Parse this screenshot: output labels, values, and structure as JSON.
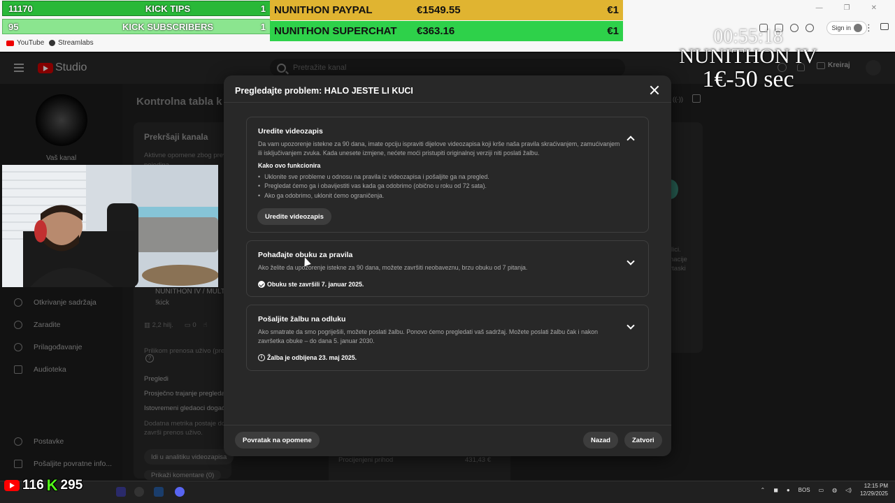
{
  "overlay": {
    "row1": {
      "num": "11170",
      "label": "KICK TIPS",
      "val": "1"
    },
    "row2": {
      "num": "95",
      "label": "KICK SUBSCRIBERS",
      "val": "1"
    },
    "paypal": {
      "name": "NUNITHON PAYPAL",
      "amount": "€1549.55",
      "val": "€1"
    },
    "superchat": {
      "name": "NUNITHON SUPERCHAT",
      "amount": "€363.16",
      "val": "€1"
    },
    "timer_top": "00:55:18",
    "timer_title": "NUNITHON IV",
    "timer_rate": "1€-50 sec",
    "youtube_count": "116",
    "kick_count": "295"
  },
  "browser": {
    "bookmarks": [
      "YouTube",
      "Streamlabs"
    ],
    "sign_in": "Sign in"
  },
  "studio": {
    "logo": "Studio",
    "search_placeholder": "Pretražite kanal",
    "create": "Kreiraj",
    "channel_label": "Vaš kanal",
    "dashboard_title": "Kontrolna tabla k",
    "card_title": "Prekršaji kanala",
    "card_line1": "Aktivne opomene zbog prevcr",
    "card_line2": "pojedina",
    "video_title": "NUNITHON IV / MULT",
    "video_sub": "!kick",
    "video_views": "2,2 hilj.",
    "video_comments": "0",
    "stats_note": "Prilikom prenosa uživo (prenos",
    "metric1": "Pregledi",
    "metric2": "Prosječno trajanje pregleda",
    "metric3": "Istovremeni gledaoci događaj",
    "metric_note1": "Dodatna metrika postaje dost",
    "metric_note2": "završi prenos uživo.",
    "btn_analytics": "Idi u analitiku videozapisa",
    "btn_comments": "Prikaži komentare (0)",
    "revenue_label": "Procijenjeni prihod",
    "revenue_value": "431,43 €",
    "right_text": [
      "lici.",
      "nacije",
      "rtaski"
    ],
    "sidebar": [
      "Otkrivanje sadržaja",
      "Zaradite",
      "Prilagođavanje",
      "Audioteka",
      "Postavke",
      "Pošaljite povratne info..."
    ]
  },
  "dialog": {
    "title": "Pregledajte problem: HALO JESTE LI KUCI",
    "section1": {
      "heading": "Uredite videozapis",
      "body": "Da vam upozorenje istekne za 90 dana, imate opciju ispraviti dijelove videozapisa koji krše naša pravila skraćivanjem, zamućivanjem ili isključivanjem zvuka. Kada unesete izmjene, nećete moći pristupiti originalnoj verziji niti poslati žalbu.",
      "how_title": "Kako ovo funkcionira",
      "bullets": [
        "Uklonite sve probleme u odnosu na pravila iz videozapisa i pošaljite ga na pregled.",
        "Pregledat ćemo ga i obavijestiti vas kada ga odobrimo (obično u roku od 72 sata).",
        "Ako ga odobrimo, uklonit ćemo ograničenja."
      ],
      "button": "Uredite videozapis"
    },
    "section2": {
      "heading": "Pohađajte obuku za pravila",
      "body": "Ako želite da upozorenje istekne za 90 dana, možete završiti neobaveznu, brzu obuku od 7 pitanja.",
      "status": "Obuku ste završili 7. januar 2025."
    },
    "section3": {
      "heading": "Pošaljite žalbu na odluku",
      "body": "Ako smatrate da smo pogriješili, možete poslati žalbu. Ponovo ćemo pregledati vaš sadržaj. Možete poslati žalbu čak i nakon završetka obuke – do dana 5. januar 2030.",
      "status": "Žalba je odbijena 23. maj 2025."
    },
    "back_to_warnings": "Povratak na opomene",
    "back": "Nazad",
    "close": "Zatvori"
  },
  "taskbar": {
    "lang": "BOS",
    "time": "12:15 PM",
    "date": "12/29/2025"
  },
  "colors": {
    "kick_green": "#53fc18",
    "paypal_gold": "#e0b431",
    "superchat_green": "#2ed14a",
    "dialog_bg": "#282828"
  }
}
